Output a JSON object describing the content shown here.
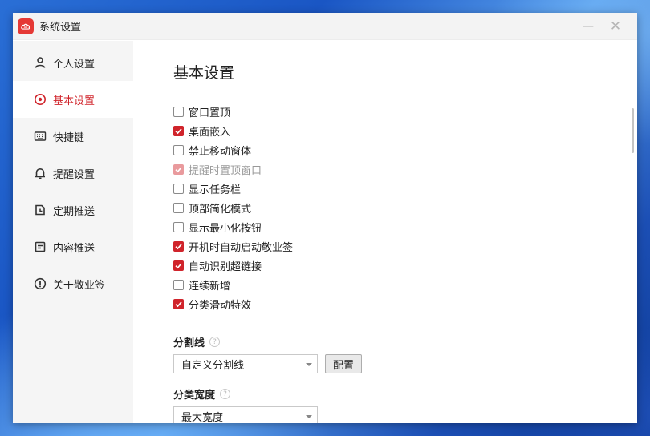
{
  "window": {
    "title": "系统设置",
    "minimize_glyph": "—",
    "close_glyph": "✕"
  },
  "sidebar": {
    "items": [
      {
        "label": "个人设置",
        "icon": "person-icon",
        "active": false
      },
      {
        "label": "基本设置",
        "icon": "settings-circle-icon",
        "active": true
      },
      {
        "label": "快捷键",
        "icon": "keyboard-icon",
        "active": false
      },
      {
        "label": "提醒设置",
        "icon": "bell-icon",
        "active": false
      },
      {
        "label": "定期推送",
        "icon": "schedule-icon",
        "active": false
      },
      {
        "label": "内容推送",
        "icon": "document-icon",
        "active": false
      },
      {
        "label": "关于敬业签",
        "icon": "info-icon",
        "active": false
      }
    ]
  },
  "main": {
    "title": "基本设置",
    "options": [
      {
        "label": "窗口置顶",
        "checked": false,
        "disabled": false
      },
      {
        "label": "桌面嵌入",
        "checked": true,
        "disabled": false
      },
      {
        "label": "禁止移动窗体",
        "checked": false,
        "disabled": false
      },
      {
        "label": "提醒时置顶窗口",
        "checked": true,
        "disabled": true
      },
      {
        "label": "显示任务栏",
        "checked": false,
        "disabled": false
      },
      {
        "label": "顶部简化模式",
        "checked": false,
        "disabled": false
      },
      {
        "label": "显示最小化按钮",
        "checked": false,
        "disabled": false
      },
      {
        "label": "开机时自动启动敬业签",
        "checked": true,
        "disabled": false
      },
      {
        "label": "自动识别超链接",
        "checked": true,
        "disabled": false
      },
      {
        "label": "连续新增",
        "checked": false,
        "disabled": false
      },
      {
        "label": "分类滑动特效",
        "checked": true,
        "disabled": false
      }
    ],
    "divider": {
      "label": "分割线",
      "help": "?",
      "selected": "自定义分割线",
      "config_button": "配置"
    },
    "category_width": {
      "label": "分类宽度",
      "help": "?",
      "selected": "最大宽度"
    }
  },
  "colors": {
    "accent": "#d0242b",
    "sidebar_bg": "#f5f5f5",
    "titlebar_bg": "#f3f3f3"
  }
}
